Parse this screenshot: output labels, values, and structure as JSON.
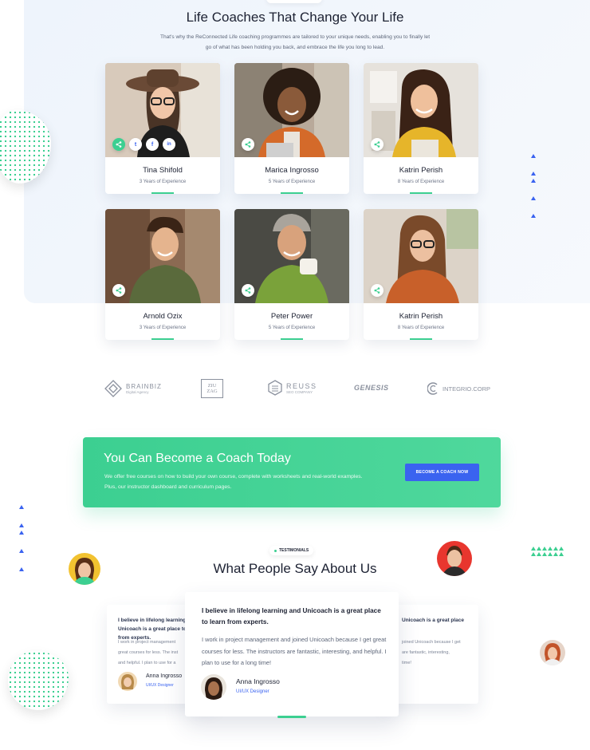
{
  "coaches_section": {
    "title": "Life Coaches That Change Your Life",
    "description": "That's why the ReConnected Life coaching programmes are tailored to your unique needs, enabling you to finally let go of what has been holding you back, and embrace the life you long to lead."
  },
  "coaches": [
    {
      "name": "Tina Shifold",
      "experience": "3 Years of Experience"
    },
    {
      "name": "Marica Ingrosso",
      "experience": "5 Years of Experience"
    },
    {
      "name": "Katrin Perish",
      "experience": "8 Years of Experience"
    },
    {
      "name": "Arnold Ozix",
      "experience": "3 Years of Experience"
    },
    {
      "name": "Peter Power",
      "experience": "5 Years of Experience"
    },
    {
      "name": "Katrin Perish",
      "experience": "8 Years of Experience"
    }
  ],
  "social_icons": {
    "twitter": "t",
    "facebook": "f",
    "linkedin": "in"
  },
  "logos": [
    {
      "name": "BRAINBIZ",
      "sub": "Digital Agency"
    },
    {
      "name": "ZIU ZAG",
      "sub": ""
    },
    {
      "name": "REUSS",
      "sub": "SEO COMPANY"
    },
    {
      "name": "GENESIS",
      "sub": ""
    },
    {
      "name": "INTEGRIO.CORP",
      "sub": ""
    }
  ],
  "cta": {
    "title": "You Can Become a Coach Today",
    "description": "We offer free courses on how to build your own course, complete with worksheets and real-world examples. Plus, our instructor dashboard and curriculum pages.",
    "button_label": "BECOME A COACH NOW"
  },
  "testimonials_section": {
    "badge": "TESTIMONIALS",
    "title": "What People Say About Us"
  },
  "testimonials": {
    "main": {
      "quote": "I believe in lifelong learning and Unicoach is a great place to learn from experts.",
      "body": "I work in project management and joined Unicoach because I get great courses for less. The instructors are fantastic, interesting, and helpful. I plan to use for a long time!",
      "author": "Anna Ingrosso",
      "role": "UI/UX Designer"
    },
    "left": {
      "quote": "I believe in lifelong learning and Unicoach is a great place to learn from experts.",
      "body_lines": [
        "I work in project management",
        "great courses for less. The inst",
        "and helpful. I plan to use for a"
      ],
      "author": "Anna Ingrosso",
      "role": "UI/UX Designer"
    },
    "right": {
      "quote": "Unicoach is a great place",
      "body_lines": [
        "joined Unicoach because I get",
        "are fantastic, interesting,",
        "time!"
      ]
    }
  },
  "colors": {
    "accent_green": "#3ccf91",
    "accent_blue": "#3a63f0",
    "text_dark": "#1d2233"
  }
}
